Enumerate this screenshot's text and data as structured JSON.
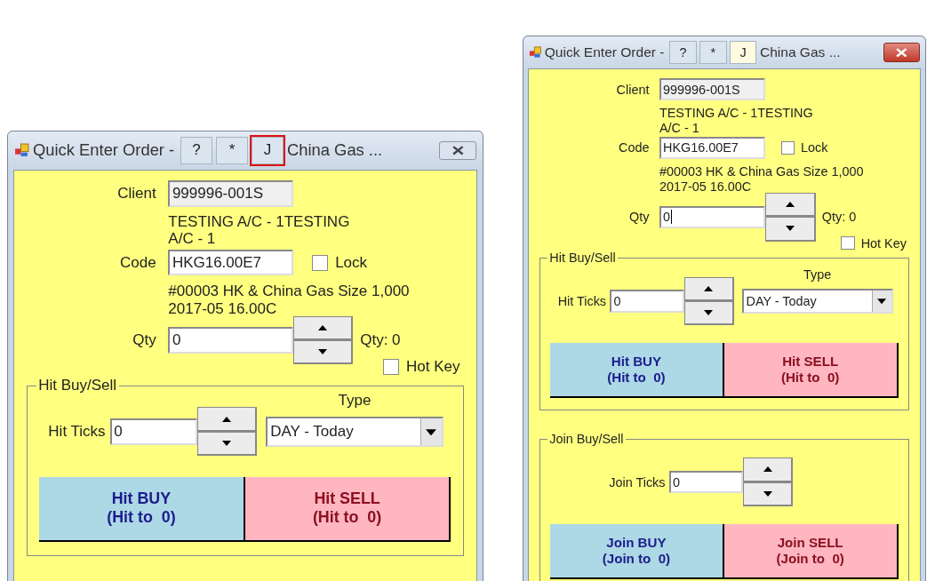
{
  "windows": [
    {
      "title": "Quick Enter Order -",
      "title_buttons": [
        {
          "label": "?",
          "selected": false,
          "highlighted": false
        },
        {
          "label": "*",
          "selected": false,
          "highlighted": false
        },
        {
          "label": "J",
          "selected": false,
          "highlighted": true
        }
      ],
      "subtitle": "China Gas ...",
      "close_active": false,
      "client": {
        "label": "Client",
        "value": "999996-001S"
      },
      "client_description": [
        "TESTING A/C - 1TESTING",
        "A/C - 1"
      ],
      "code": {
        "label": "Code",
        "value": "HKG16.00E7"
      },
      "lock": {
        "label": "Lock",
        "checked": false
      },
      "code_description": [
        "#00003 HK & China Gas Size 1,000",
        "2017-05 16.00C"
      ],
      "qty": {
        "label": "Qty",
        "value": "0",
        "focused": false,
        "reading": "Qty: 0"
      },
      "hot_key": {
        "label": "Hot Key",
        "checked": false
      },
      "groups": [
        {
          "kind": "hit",
          "title": "Hit Buy/Sell",
          "ticks_label": "Hit Ticks",
          "ticks_value": "0",
          "type_label": "Type",
          "type_value": "DAY - Today",
          "buttons": [
            {
              "kind": "buy",
              "lines": [
                "Hit BUY",
                "(Hit to  0)"
              ]
            },
            {
              "kind": "sell",
              "lines": [
                "Hit SELL",
                "(Hit to  0)"
              ]
            }
          ]
        }
      ]
    },
    {
      "title": "Quick Enter Order -",
      "title_buttons": [
        {
          "label": "?",
          "selected": false,
          "highlighted": false
        },
        {
          "label": "*",
          "selected": false,
          "highlighted": false
        },
        {
          "label": "J",
          "selected": true,
          "highlighted": false
        }
      ],
      "subtitle": "China Gas ...",
      "close_active": true,
      "client": {
        "label": "Client",
        "value": "999996-001S"
      },
      "client_description": [
        "TESTING A/C - 1TESTING",
        "A/C - 1"
      ],
      "code": {
        "label": "Code",
        "value": "HKG16.00E7"
      },
      "lock": {
        "label": "Lock",
        "checked": false
      },
      "code_description": [
        "#00003 HK & China Gas Size 1,000",
        "2017-05 16.00C"
      ],
      "qty": {
        "label": "Qty",
        "value": "0",
        "focused": true,
        "reading": "Qty: 0"
      },
      "hot_key": {
        "label": "Hot Key",
        "checked": false
      },
      "groups": [
        {
          "kind": "hit",
          "title": "Hit Buy/Sell",
          "ticks_label": "Hit Ticks",
          "ticks_value": "0",
          "type_label": "Type",
          "type_value": "DAY - Today",
          "buttons": [
            {
              "kind": "buy",
              "lines": [
                "Hit BUY",
                "(Hit to  0)"
              ]
            },
            {
              "kind": "sell",
              "lines": [
                "Hit SELL",
                "(Hit to  0)"
              ]
            }
          ]
        },
        {
          "kind": "join",
          "title": "Join Buy/Sell",
          "ticks_label": "Join Ticks",
          "ticks_value": "0",
          "buttons": [
            {
              "kind": "buy",
              "lines": [
                "Join BUY",
                "(Join to  0)"
              ]
            },
            {
              "kind": "sell",
              "lines": [
                "Join SELL",
                "(Join to  0)"
              ]
            }
          ]
        }
      ]
    }
  ]
}
